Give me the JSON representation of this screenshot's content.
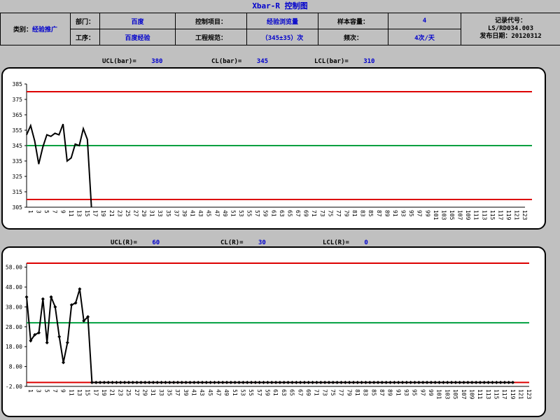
{
  "header": {
    "title": "Xbar-R 控制图",
    "category_label": "类别：",
    "category_value": "经验推广",
    "dept_label": "部门：",
    "dept_value": "百度",
    "process_label": "工序：",
    "process_value": "百度经验",
    "control_item_label": "控制项目：",
    "control_item_value": "经验浏览量",
    "spec_label": "工程规范：",
    "spec_value": "（345±35）次",
    "sample_size_label": "样本容量：",
    "sample_size_value": "4",
    "frequency_label": "频次：",
    "frequency_value": "4次/天",
    "record_label": "记录代号：",
    "record_code": "LS/RD034.003",
    "publish_date": "发布日期：20120312"
  },
  "xbar_stats": {
    "ucl_label": "UCL(bar)=",
    "ucl_value": "380",
    "cl_label": "CL(bar)=",
    "cl_value": "345",
    "lcl_label": "LCL(bar)=",
    "lcl_value": "310"
  },
  "r_stats": {
    "ucl_label": "UCL(R)=",
    "ucl_value": "60",
    "cl_label": "CL(R)=",
    "cl_value": "30",
    "lcl_label": "LCL(R)=",
    "lcl_value": "0"
  },
  "colors": {
    "limit": "#dd0000",
    "center": "#00a040",
    "series": "#000000"
  },
  "chart_data": [
    {
      "type": "line",
      "chart": "xbar",
      "x_tick_labels": [
        "1",
        "3",
        "5",
        "7",
        "9",
        "11",
        "13",
        "15",
        "17",
        "19",
        "21",
        "23",
        "25",
        "27",
        "29",
        "31",
        "33",
        "35",
        "37",
        "39",
        "41",
        "43",
        "45",
        "47",
        "49",
        "51",
        "53",
        "55",
        "57",
        "59",
        "61",
        "63",
        "65",
        "67",
        "69",
        "71",
        "73",
        "75",
        "77",
        "79",
        "81",
        "83",
        "85",
        "87",
        "89",
        "91",
        "93",
        "95",
        "97",
        "99",
        "101",
        "103",
        "105",
        "107",
        "109",
        "111",
        "113",
        "115",
        "117",
        "119",
        "121",
        "123"
      ],
      "y_tick_labels": [
        "385",
        "375",
        "365",
        "355",
        "345",
        "335",
        "325",
        "315",
        "305"
      ],
      "ylim": [
        305,
        385
      ],
      "xlim": [
        1,
        124
      ],
      "ucl": 380,
      "cl": 345,
      "lcl": 310,
      "x": [
        1,
        2,
        3,
        4,
        5,
        6,
        7,
        8,
        9,
        10,
        11,
        12,
        13,
        14,
        15,
        16,
        17
      ],
      "values": [
        352,
        358,
        348,
        333,
        344,
        352,
        351,
        353,
        352,
        359,
        335,
        337,
        346,
        345,
        356,
        349,
        305
      ],
      "marker": "none"
    },
    {
      "type": "line",
      "chart": "range",
      "x_tick_labels": [
        "1",
        "3",
        "5",
        "7",
        "9",
        "11",
        "13",
        "15",
        "17",
        "19",
        "21",
        "23",
        "25",
        "27",
        "29",
        "31",
        "33",
        "35",
        "37",
        "39",
        "41",
        "43",
        "45",
        "47",
        "49",
        "51",
        "53",
        "55",
        "57",
        "59",
        "61",
        "63",
        "65",
        "67",
        "69",
        "71",
        "73",
        "75",
        "77",
        "79",
        "81",
        "83",
        "85",
        "87",
        "89",
        "91",
        "93",
        "95",
        "97",
        "99",
        "101",
        "103",
        "105",
        "107",
        "109",
        "111",
        "113",
        "115",
        "117",
        "119",
        "121",
        "123"
      ],
      "y_tick_labels": [
        "58.00",
        "48.00",
        "38.00",
        "28.00",
        "18.00",
        "8.00",
        "-2.00"
      ],
      "ylim": [
        -2,
        60
      ],
      "xlim": [
        1,
        124
      ],
      "ucl": 60,
      "cl": 30,
      "lcl": 0,
      "x": [
        1,
        2,
        3,
        4,
        5,
        6,
        7,
        8,
        9,
        10,
        11,
        12,
        13,
        14,
        15,
        16,
        17,
        18,
        19,
        20,
        21,
        22,
        23,
        24,
        25,
        26,
        27,
        28,
        29,
        30,
        31,
        32,
        33,
        34,
        35,
        36,
        37,
        38,
        39,
        40,
        41,
        42,
        43,
        44,
        45,
        46,
        47,
        48,
        49,
        50,
        51,
        52,
        53,
        54,
        55,
        56,
        57,
        58,
        59,
        60,
        61,
        62,
        63,
        64,
        65,
        66,
        67,
        68,
        69,
        70,
        71,
        72,
        73,
        74,
        75,
        76,
        77,
        78,
        79,
        80,
        81,
        82,
        83,
        84,
        85,
        86,
        87,
        88,
        89,
        90,
        91,
        92,
        93,
        94,
        95,
        96,
        97,
        98,
        99,
        100,
        101,
        102,
        103,
        104,
        105,
        106,
        107,
        108,
        109,
        110,
        111,
        112,
        113,
        114,
        115,
        116,
        117,
        118,
        119,
        120,
        121,
        122,
        123,
        124
      ],
      "values": [
        43,
        21,
        24,
        25,
        42,
        20,
        43,
        38,
        23,
        10,
        20,
        39,
        40,
        47,
        31,
        33,
        0,
        0,
        0,
        0,
        0,
        0,
        0,
        0,
        0,
        0,
        0,
        0,
        0,
        0,
        0,
        0,
        0,
        0,
        0,
        0,
        0,
        0,
        0,
        0,
        0,
        0,
        0,
        0,
        0,
        0,
        0,
        0,
        0,
        0,
        0,
        0,
        0,
        0,
        0,
        0,
        0,
        0,
        0,
        0,
        0,
        0,
        0,
        0,
        0,
        0,
        0,
        0,
        0,
        0,
        0,
        0,
        0,
        0,
        0,
        0,
        0,
        0,
        0,
        0,
        0,
        0,
        0,
        0,
        0,
        0,
        0,
        0,
        0,
        0,
        0,
        0,
        0,
        0,
        0,
        0,
        0,
        0,
        0,
        0,
        0,
        0,
        0,
        0,
        0,
        0,
        0,
        0,
        0,
        0,
        0,
        0,
        0,
        0,
        0,
        0,
        0,
        0,
        0,
        0
      ],
      "marker": "diamond"
    }
  ]
}
